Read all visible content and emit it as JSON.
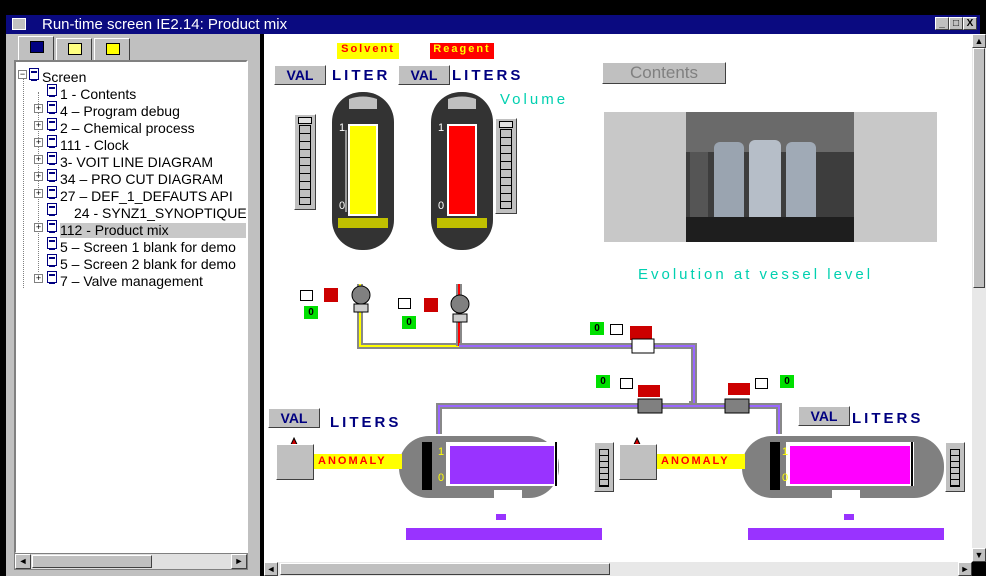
{
  "window": {
    "title": "Run-time screen IE2.14: Product mix",
    "controls": [
      "_",
      "□",
      "X"
    ]
  },
  "left_panel": {
    "tabs": [
      "screens-tab",
      "messages-tab",
      "objects-tab"
    ],
    "tree": {
      "root": "Screen",
      "items": [
        {
          "label": "1 - Contents",
          "expandable": false
        },
        {
          "label": "4 – Program debug",
          "expandable": true
        },
        {
          "label": "2 – Chemical process",
          "expandable": true
        },
        {
          "label": "111 - Clock",
          "expandable": true
        },
        {
          "label": "3- VOIT LINE DIAGRAM",
          "expandable": true
        },
        {
          "label": "34 – PRO CUT DIAGRAM",
          "expandable": true
        },
        {
          "label": "27 – DEF_1_DEFAUTS API",
          "expandable": true
        },
        {
          "label": "24 - SYNZ1_SYNOPTIQUE",
          "expandable": false,
          "indent": true
        },
        {
          "label": "112 - Product mix",
          "expandable": true,
          "selected": true
        },
        {
          "label": "5 – Screen 1 blank for demo",
          "expandable": false
        },
        {
          "label": "5 – Screen 2 blank for demo",
          "expandable": false
        },
        {
          "label": "7 – Valve management",
          "expandable": true
        }
      ]
    }
  },
  "synoptic": {
    "solvent_label": "Solvent",
    "reagent_label": "Reagent",
    "val_label": "VAL",
    "liter_label": "LITER",
    "liters_label": "LITERS",
    "volume_label": "Volume",
    "contents_button": "Contents",
    "evolution_label": "Evolution at vessel level",
    "anomaly_label": "ANOMALY",
    "zero": "0",
    "scale_top": "1",
    "scale_bottom": "0",
    "colors": {
      "solvent": "#ffff00",
      "reagent": "#ff0000",
      "mix_left": "#9933ff",
      "mix_right": "#ff00ff",
      "pipe": "#9966ff",
      "teal_text": "#00d0b0",
      "indicator": "#00e000"
    }
  }
}
